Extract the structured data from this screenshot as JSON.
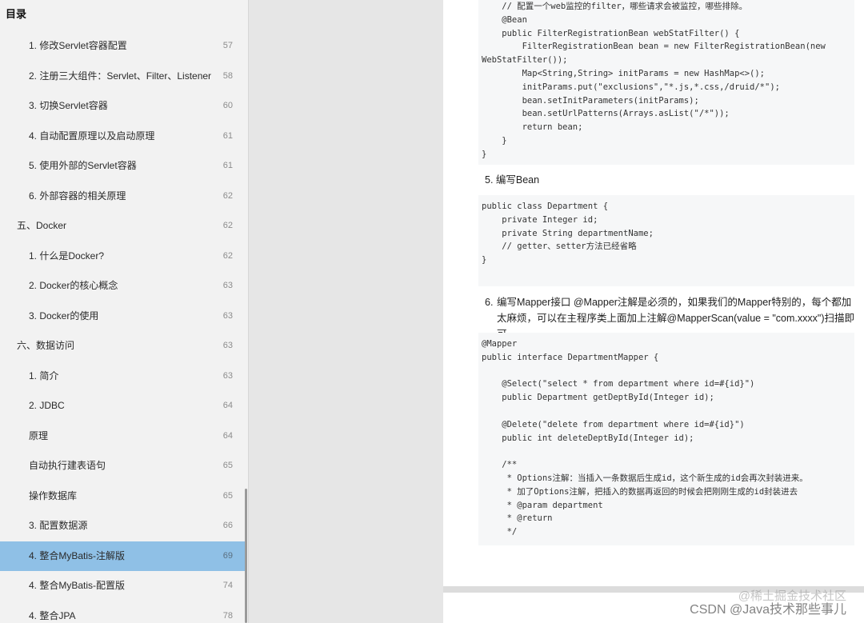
{
  "toc": {
    "header": "目录",
    "items": [
      {
        "label": "1. 修改Servlet容器配置",
        "page": "57",
        "level": 2
      },
      {
        "label": "2. 注册三大组件：Servlet、Filter、Listener",
        "page": "58",
        "level": 2
      },
      {
        "label": "3. 切换Servlet容器",
        "page": "60",
        "level": 2
      },
      {
        "label": "4. 自动配置原理以及启动原理",
        "page": "61",
        "level": 2
      },
      {
        "label": "5. 使用外部的Servlet容器",
        "page": "61",
        "level": 2
      },
      {
        "label": "6. 外部容器的相关原理",
        "page": "62",
        "level": 2
      },
      {
        "label": "五、Docker",
        "page": "62",
        "level": 1
      },
      {
        "label": "1. 什么是Docker?",
        "page": "62",
        "level": 2
      },
      {
        "label": "2. Docker的核心概念",
        "page": "63",
        "level": 2
      },
      {
        "label": "3. Docker的使用",
        "page": "63",
        "level": 2
      },
      {
        "label": "六、数据访问",
        "page": "63",
        "level": 1
      },
      {
        "label": "1. 简介",
        "page": "63",
        "level": 2
      },
      {
        "label": "2. JDBC",
        "page": "64",
        "level": 2
      },
      {
        "label": "原理",
        "page": "64",
        "level": 2
      },
      {
        "label": "自动执行建表语句",
        "page": "65",
        "level": 2
      },
      {
        "label": "操作数据库",
        "page": "65",
        "level": 2
      },
      {
        "label": "3. 配置数据源",
        "page": "66",
        "level": 2
      },
      {
        "label": "4. 整合MyBatis-注解版",
        "page": "69",
        "level": 2,
        "active": true
      },
      {
        "label": "4. 整合MyBatis-配置版",
        "page": "74",
        "level": 2
      },
      {
        "label": "4. 整合JPA",
        "page": "78",
        "level": 2
      }
    ]
  },
  "document": {
    "code_block_1": [
      "    // 配置一个web监控的filter，哪些请求会被监控，哪些排除。",
      "    @Bean",
      "    public FilterRegistrationBean webStatFilter() {",
      "        FilterRegistrationBean bean = new FilterRegistrationBean(new",
      "WebStatFilter());",
      "        Map<String,String> initParams = new HashMap<>();",
      "        initParams.put(\"exclusions\",\"*.js,*.css,/druid/*\");",
      "        bean.setInitParameters(initParams);",
      "        bean.setUrlPatterns(Arrays.asList(\"/*\"));",
      "        return bean;",
      "    }",
      "}"
    ],
    "step5": "5. 编写Bean",
    "code_block_2": [
      "public class Department {",
      "    private Integer id;",
      "    private String departmentName;",
      "    // getter、setter方法已经省略",
      "}"
    ],
    "step6_num": "6.",
    "step6_text": "编写Mapper接口 @Mapper注解是必须的，如果我们的Mapper特别的，每个都加太麻烦，可以在主程序类上面加上注解@MapperScan(value = \"com.xxxx\")扫描即可。",
    "code_block_3": [
      "@Mapper",
      "public interface DepartmentMapper {",
      "",
      "    @Select(\"select * from department where id=#{id}\")",
      "    public Department getDeptById(Integer id);",
      "",
      "    @Delete(\"delete from department where id=#{id}\")",
      "    public int deleteDeptById(Integer id);",
      "",
      "    /**",
      "     * Options注解：当插入一条数据后生成id，这个新生成的id会再次封装进来。",
      "     * 加了Options注解，把插入的数据再返回的时候会把刚刚生成的id封装进去",
      "     * @param department",
      "     * @return",
      "     */"
    ]
  },
  "watermark": {
    "line1": "@稀土掘金技术社区",
    "line2": "CSDN @Java技术那些事儿"
  }
}
